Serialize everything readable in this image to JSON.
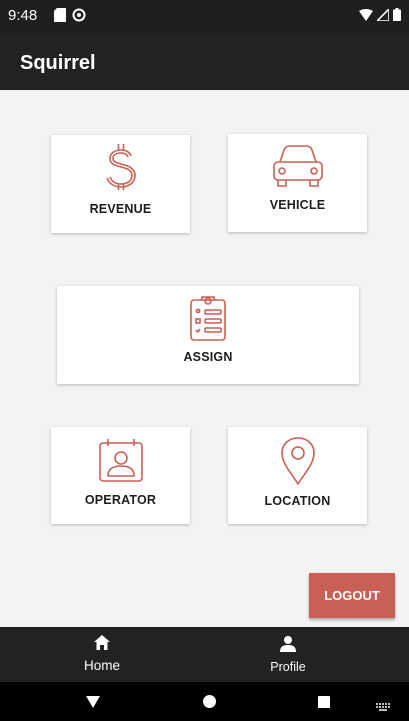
{
  "status_bar": {
    "time": "9:48"
  },
  "app_bar": {
    "title": "Squirrel"
  },
  "cards": {
    "revenue": "REVENUE",
    "vehicle": "VEHICLE",
    "assign": "ASSIGN",
    "operator": "OPERATOR",
    "location": "LOCATION"
  },
  "logout_label": "LOGOUT",
  "bottom_nav": {
    "home": "Home",
    "profile": "Profile"
  },
  "colors": {
    "accent": "#c96055",
    "app_bar": "#222222",
    "background": "#f3f3f3"
  },
  "icons": [
    "dollar-icon",
    "car-icon",
    "clipboard-icon",
    "operator-badge-icon",
    "location-pin-icon",
    "home-icon",
    "person-icon"
  ]
}
